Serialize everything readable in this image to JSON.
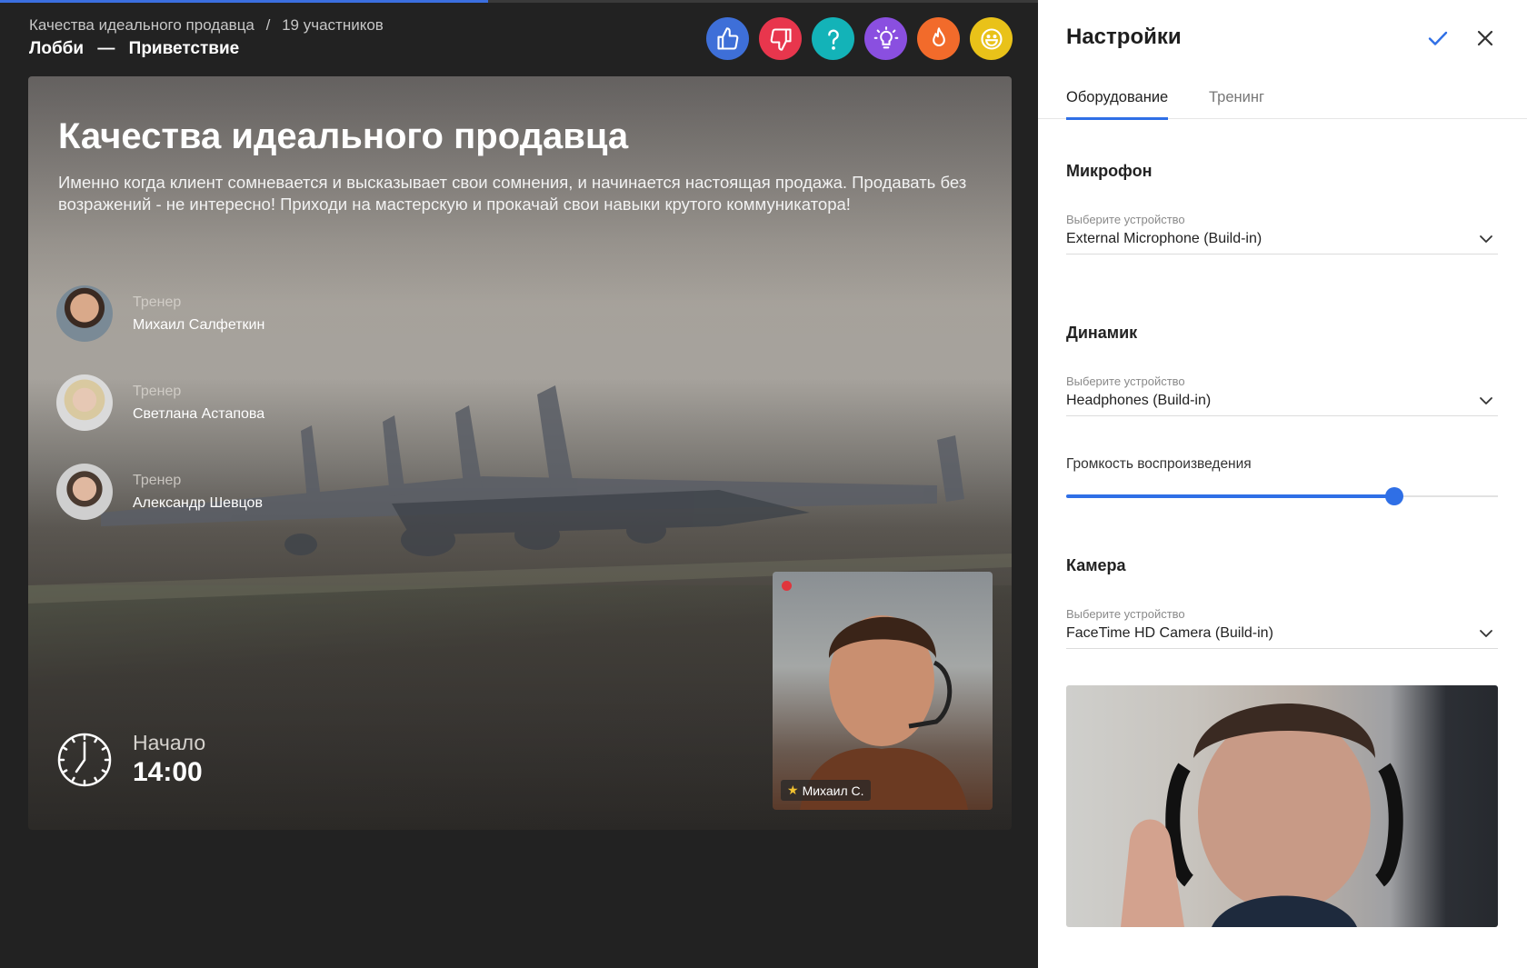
{
  "progress": {
    "fraction": 0.47
  },
  "header": {
    "course": "Качества идеального продавца",
    "separator": "/",
    "participants": "19 участников",
    "room": "Лобби",
    "dash": "—",
    "section": "Приветствие"
  },
  "reactions": [
    {
      "name": "thumbs-up-icon",
      "color": "#3e6fd8"
    },
    {
      "name": "thumbs-down-icon",
      "color": "#e8364d"
    },
    {
      "name": "question-icon",
      "color": "#13b3b8"
    },
    {
      "name": "lightbulb-icon",
      "color": "#8a4fe0"
    },
    {
      "name": "fire-icon",
      "color": "#f26b2b"
    },
    {
      "name": "smile-icon",
      "color": "#e9c219"
    }
  ],
  "stage": {
    "title": "Качества идеального продавца",
    "description": "Именно когда клиент сомневается и высказывает свои сомнения, и начинается настоящая продажа. Продавать без возражений - не интересно! Приходи на мастерскую и прокачай свои навыки крутого коммуникатора!",
    "trainers": [
      {
        "role": "Тренер",
        "name": "Михаил Салфеткин"
      },
      {
        "role": "Тренер",
        "name": "Светлана Астапова"
      },
      {
        "role": "Тренер",
        "name": "Александр Шевцов"
      }
    ],
    "start_label": "Начало",
    "start_time": "14:00",
    "pip_name": "Михаил С."
  },
  "settings": {
    "title": "Настройки",
    "tabs": [
      "Оборудование",
      "Тренинг"
    ],
    "microphone": {
      "title": "Микрофон",
      "hint": "Выберите устройство",
      "value": "External Microphone (Build-in)"
    },
    "speaker": {
      "title": "Динамик",
      "hint": "Выберите устройство",
      "value": "Headphones (Build-in)"
    },
    "volume": {
      "label": "Громкость воспроизведения",
      "level": 0.76
    },
    "camera": {
      "title": "Камера",
      "hint": "Выберите устройство",
      "value": "FaceTime HD Camera (Build-in)"
    }
  },
  "colors": {
    "accent": "#2f6fe6",
    "dark_bg": "#222222",
    "record": "#e0353c"
  }
}
